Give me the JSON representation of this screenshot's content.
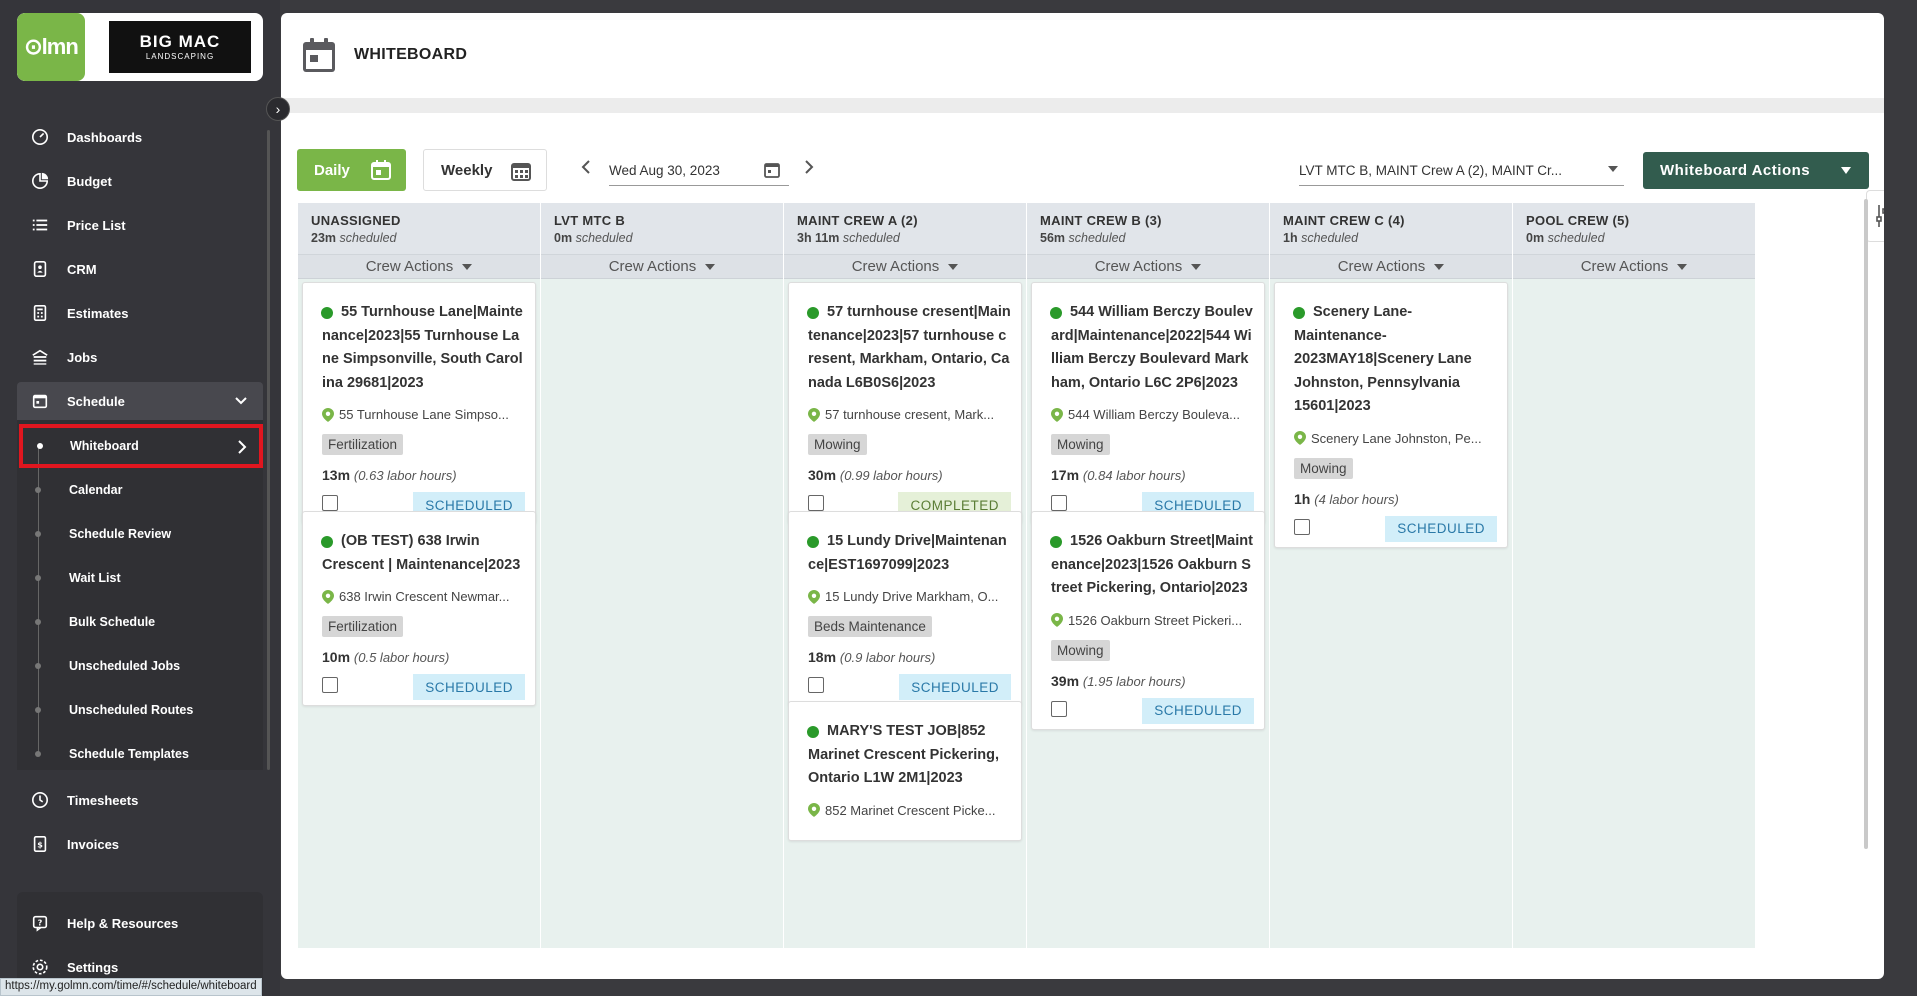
{
  "brand": {
    "lmn": "lmn",
    "big": "BIG MAC",
    "sub": "LANDSCAPING"
  },
  "sidebar": {
    "items": [
      {
        "label": "Dashboards",
        "icon": "dashboard-icon"
      },
      {
        "label": "Budget",
        "icon": "pie-chart-icon"
      },
      {
        "label": "Price List",
        "icon": "list-icon"
      },
      {
        "label": "CRM",
        "icon": "contact-book-icon"
      },
      {
        "label": "Estimates",
        "icon": "calculator-icon"
      },
      {
        "label": "Jobs",
        "icon": "jobs-icon"
      },
      {
        "label": "Schedule",
        "icon": "calendar-icon"
      }
    ],
    "schedule_sub": [
      "Whiteboard",
      "Calendar",
      "Schedule Review",
      "Wait List",
      "Bulk Schedule",
      "Unscheduled Jobs",
      "Unscheduled Routes",
      "Schedule Templates"
    ],
    "bottom_items": [
      {
        "label": "Timesheets",
        "icon": "clock-icon"
      },
      {
        "label": "Invoices",
        "icon": "invoice-icon"
      },
      {
        "label": "Help & Resources",
        "icon": "help-icon"
      },
      {
        "label": "Settings",
        "icon": "gear-icon"
      }
    ]
  },
  "status_url": "https://my.golmn.com/time/#/schedule/whiteboard",
  "header": {
    "title": "WHITEBOARD"
  },
  "toolbar": {
    "daily": "Daily",
    "weekly": "Weekly",
    "date": "Wed Aug 30, 2023",
    "crews": "LVT MTC B, MAINT Crew A (2), MAINT Cr...",
    "actions": "Whiteboard Actions"
  },
  "crew_actions_label": "Crew Actions",
  "scheduled_word": "scheduled",
  "columns": [
    {
      "name": "UNASSIGNED",
      "time": "23m",
      "cards": [
        {
          "title": "55 Turnhouse Lane|Maintenance|2023|55 Turnhouse Lane Simpsonville, South Carolina 29681|2023",
          "addr": "55 Turnhouse Lane Simpso...",
          "tag": "Fertilization",
          "time": "13m",
          "labor": "(0.63 labor hours)",
          "status": "SCHEDULED"
        },
        {
          "title": "(OB TEST) 638 Irwin Crescent | Maintenance|2023",
          "addr": "638 Irwin Crescent Newmar...",
          "tag": "Fertilization",
          "time": "10m",
          "labor": "(0.5 labor hours)",
          "status": "SCHEDULED"
        }
      ]
    },
    {
      "name": "LVT MTC B",
      "time": "0m",
      "cards": []
    },
    {
      "name": "MAINT CREW A (2)",
      "time": "3h 11m",
      "cards": [
        {
          "title": "57 turnhouse cresent|Maintenance|2023|57 turnhouse cresent, Markham, Ontario, Canada L6B0S6|2023",
          "addr": "57 turnhouse cresent, Mark...",
          "tag": "Mowing",
          "time": "30m",
          "labor": "(0.99 labor hours)",
          "status": "COMPLETED"
        },
        {
          "title": "15 Lundy Drive|Maintenance|EST1697099|2023",
          "addr": "15 Lundy Drive Markham, O...",
          "tag": "Beds Maintenance",
          "time": "18m",
          "labor": "(0.9 labor hours)",
          "status": "SCHEDULED"
        },
        {
          "title": "MARY'S TEST JOB|852 Marinet Crescent Pickering, Ontario L1W 2M1|2023",
          "addr": "852 Marinet Crescent Picke..."
        }
      ]
    },
    {
      "name": "MAINT CREW B (3)",
      "time": "56m",
      "cards": [
        {
          "title": "544 William Berczy Boulevard|Maintenance|2022|544 William Berczy Boulevard Markham, Ontario L6C 2P6|2023",
          "addr": "544 William Berczy Bouleva...",
          "tag": "Mowing",
          "time": "17m",
          "labor": "(0.84 labor hours)",
          "status": "SCHEDULED"
        },
        {
          "title": "1526 Oakburn Street|Maintenance|2023|1526 Oakburn Street Pickering, Ontario|2023",
          "addr": "1526 Oakburn Street Pickeri...",
          "tag": "Mowing",
          "time": "39m",
          "labor": "(1.95 labor hours)",
          "status": "SCHEDULED"
        }
      ]
    },
    {
      "name": "MAINT CREW C (4)",
      "time": "1h",
      "cards": [
        {
          "title": "Scenery Lane-Maintenance-2023MAY18|Scenery Lane Johnston, Pennsylvania 15601|2023",
          "addr": "Scenery Lane Johnston, Pe...",
          "tag": "Mowing",
          "time": "1h",
          "labor": "(4 labor hours)",
          "status": "SCHEDULED"
        }
      ]
    },
    {
      "name": "POOL CREW (5)",
      "time": "0m",
      "cards": []
    }
  ],
  "colors": {
    "green": "#7ab648",
    "actions": "#325c4e",
    "sidebar": "#35353a"
  }
}
